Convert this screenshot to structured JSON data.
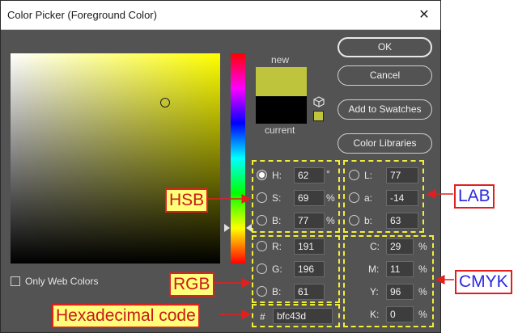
{
  "window": {
    "title": "Color Picker (Foreground Color)",
    "close_glyph": "✕"
  },
  "preview": {
    "new_label": "new",
    "current_label": "current",
    "new_color": "#bfc43d",
    "current_color": "#000000"
  },
  "buttons": {
    "ok": "OK",
    "cancel": "Cancel",
    "add_to_swatches": "Add to Swatches",
    "color_libraries": "Color Libraries"
  },
  "only_web_colors": "Only Web Colors",
  "hsb": {
    "h": {
      "label": "H:",
      "value": "62",
      "unit": "°"
    },
    "s": {
      "label": "S:",
      "value": "69",
      "unit": "%"
    },
    "b": {
      "label": "B:",
      "value": "77",
      "unit": "%"
    }
  },
  "rgb": {
    "r": {
      "label": "R:",
      "value": "191"
    },
    "g": {
      "label": "G:",
      "value": "196"
    },
    "b": {
      "label": "B:",
      "value": "61"
    }
  },
  "lab": {
    "l": {
      "label": "L:",
      "value": "77"
    },
    "a": {
      "label": "a:",
      "value": "-14"
    },
    "b": {
      "label": "b:",
      "value": "63"
    }
  },
  "cmyk": {
    "c": {
      "label": "C:",
      "value": "29",
      "unit": "%"
    },
    "m": {
      "label": "M:",
      "value": "11",
      "unit": "%"
    },
    "y": {
      "label": "Y:",
      "value": "96",
      "unit": "%"
    },
    "k": {
      "label": "K:",
      "value": "0",
      "unit": "%"
    }
  },
  "hex": {
    "label": "#",
    "value": "bfc43d"
  },
  "annotations": {
    "hsb": "HSB",
    "rgb": "RGB",
    "lab": "LAB",
    "cmyk": "CMYK",
    "hex": "Hexadecimal code"
  },
  "colors": {
    "dialog_bg": "#535353",
    "annotation_dash": "#f2ee3a",
    "annotation_red": "#e21f1f",
    "annotation_blue": "#2a2adf",
    "callout_yellow": "#ffff7a"
  }
}
